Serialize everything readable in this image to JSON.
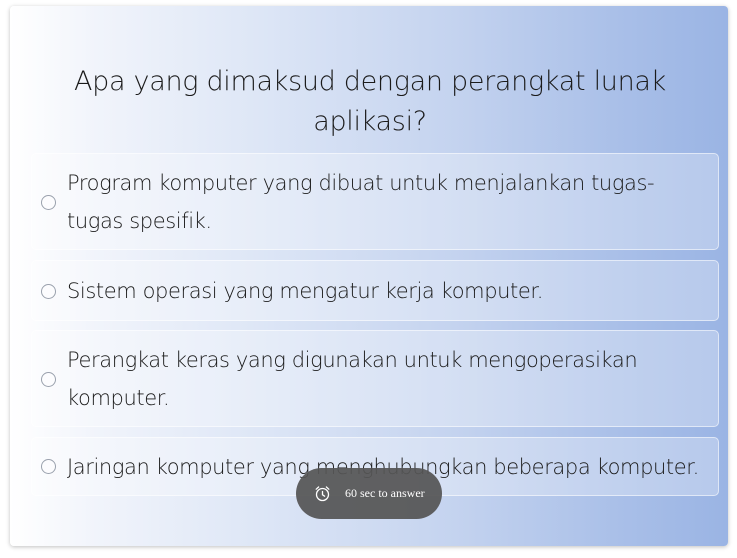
{
  "quiz": {
    "question": "Apa yang dimaksud dengan perangkat lunak aplikasi?",
    "options": [
      {
        "label": "Program komputer yang dibuat untuk menjalankan tugas-tugas spesifik.",
        "selected": false
      },
      {
        "label": "Sistem operasi yang mengatur kerja komputer.",
        "selected": false
      },
      {
        "label": "Perangkat keras yang digunakan untuk mengoperasikan komputer.",
        "selected": false
      },
      {
        "label": "Jaringan komputer yang menghubungkan beberapa komputer.",
        "selected": false
      }
    ],
    "timer": {
      "icon": "alarm-clock-icon",
      "text": "60 sec to answer"
    }
  },
  "colors": {
    "gradient_start": "#ffffff",
    "gradient_end": "#9ab4e4",
    "text": "#1b1b1b",
    "timer_bg": "#555555"
  }
}
